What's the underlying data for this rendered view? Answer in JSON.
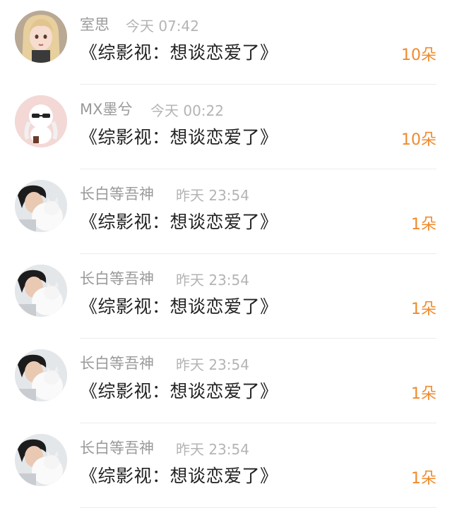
{
  "gifts": [
    {
      "name": "室思",
      "time": "今天 07:42",
      "title": "《综影视：想谈恋爱了》",
      "count": "10朵",
      "avatar": "anime-girl-avatar"
    },
    {
      "name": "MX墨兮",
      "time": "今天 00:22",
      "title": "《综影视：想谈恋爱了》",
      "count": "10朵",
      "avatar": "chibi-sunglasses-avatar"
    },
    {
      "name": "长白等吾神",
      "time": "昨天 23:54",
      "title": "《综影视：想谈恋爱了》",
      "count": "1朵",
      "avatar": "person-with-cat-avatar"
    },
    {
      "name": "长白等吾神",
      "time": "昨天 23:54",
      "title": "《综影视：想谈恋爱了》",
      "count": "1朵",
      "avatar": "person-with-cat-avatar"
    },
    {
      "name": "长白等吾神",
      "time": "昨天 23:54",
      "title": "《综影视：想谈恋爱了》",
      "count": "1朵",
      "avatar": "person-with-cat-avatar"
    },
    {
      "name": "长白等吾神",
      "time": "昨天 23:54",
      "title": "《综影视：想谈恋爱了》",
      "count": "1朵",
      "avatar": "person-with-cat-avatar"
    }
  ],
  "colors": {
    "count": "#f08a2c",
    "name": "#9a9a9a",
    "time": "#b4b4b4",
    "title": "#222222"
  }
}
